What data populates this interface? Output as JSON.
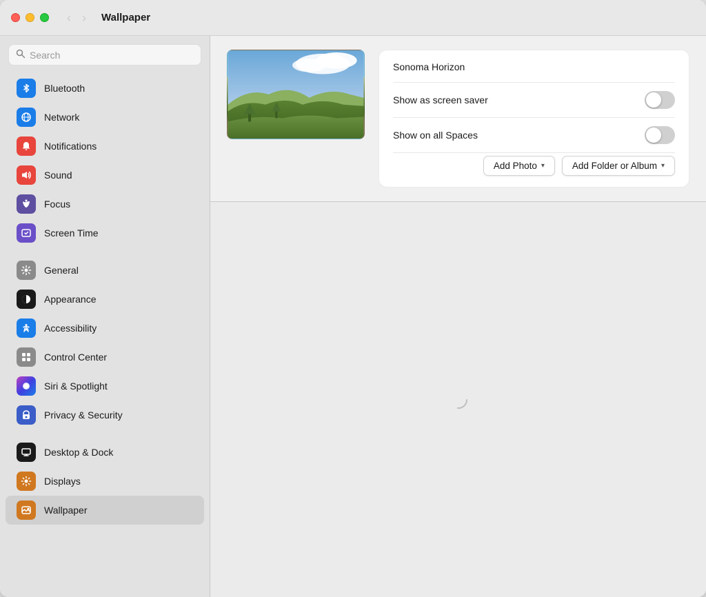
{
  "window": {
    "title": "Wallpaper"
  },
  "traffic_lights": {
    "close": "close",
    "minimize": "minimize",
    "maximize": "maximize"
  },
  "nav": {
    "back_label": "‹",
    "forward_label": "›"
  },
  "search": {
    "placeholder": "Search"
  },
  "sidebar": {
    "items": [
      {
        "id": "bluetooth",
        "label": "Bluetooth",
        "icon": "bluetooth-icon",
        "icon_char": "✦",
        "icon_class": "ic-bluetooth",
        "separator_before": false
      },
      {
        "id": "network",
        "label": "Network",
        "icon": "network-icon",
        "icon_char": "🌐",
        "icon_class": "ic-network",
        "separator_before": false
      },
      {
        "id": "notifications",
        "label": "Notifications",
        "icon": "notifications-icon",
        "icon_char": "🔔",
        "icon_class": "ic-notifications",
        "separator_before": false
      },
      {
        "id": "sound",
        "label": "Sound",
        "icon": "sound-icon",
        "icon_char": "🔊",
        "icon_class": "ic-sound",
        "separator_before": false
      },
      {
        "id": "focus",
        "label": "Focus",
        "icon": "focus-icon",
        "icon_char": "🌙",
        "icon_class": "ic-focus",
        "separator_before": false
      },
      {
        "id": "screentime",
        "label": "Screen Time",
        "icon": "screentime-icon",
        "icon_char": "⏳",
        "icon_class": "ic-screentime",
        "separator_before": false
      },
      {
        "id": "general",
        "label": "General",
        "icon": "general-icon",
        "icon_char": "⚙",
        "icon_class": "ic-general",
        "separator_before": true
      },
      {
        "id": "appearance",
        "label": "Appearance",
        "icon": "appearance-icon",
        "icon_char": "◉",
        "icon_class": "ic-appearance",
        "separator_before": false
      },
      {
        "id": "accessibility",
        "label": "Accessibility",
        "icon": "accessibility-icon",
        "icon_char": "♿",
        "icon_class": "ic-accessibility",
        "separator_before": false
      },
      {
        "id": "controlcenter",
        "label": "Control Center",
        "icon": "controlcenter-icon",
        "icon_char": "⊞",
        "icon_class": "ic-controlcenter",
        "separator_before": false
      },
      {
        "id": "siri",
        "label": "Siri & Spotlight",
        "icon": "siri-icon",
        "icon_char": "◉",
        "icon_class": "ic-siri",
        "separator_before": false
      },
      {
        "id": "privacy",
        "label": "Privacy & Security",
        "icon": "privacy-icon",
        "icon_char": "✋",
        "icon_class": "ic-privacy",
        "separator_before": false
      },
      {
        "id": "desktop",
        "label": "Desktop & Dock",
        "icon": "desktop-icon",
        "icon_char": "▬",
        "icon_class": "ic-desktop",
        "separator_before": true
      },
      {
        "id": "displays",
        "label": "Displays",
        "icon": "displays-icon",
        "icon_char": "☀",
        "icon_class": "ic-displays",
        "separator_before": false
      },
      {
        "id": "wallpaper",
        "label": "Wallpaper",
        "icon": "wallpaper-icon",
        "icon_char": "✦",
        "icon_class": "ic-wallpaper",
        "separator_before": false,
        "active": true
      }
    ]
  },
  "wallpaper": {
    "name": "Sonoma Horizon",
    "show_screensaver_label": "Show as screen saver",
    "show_screensaver_on": false,
    "show_spaces_label": "Show on all Spaces",
    "show_spaces_on": false,
    "add_photo_label": "Add Photo",
    "add_folder_label": "Add Folder or Album"
  }
}
